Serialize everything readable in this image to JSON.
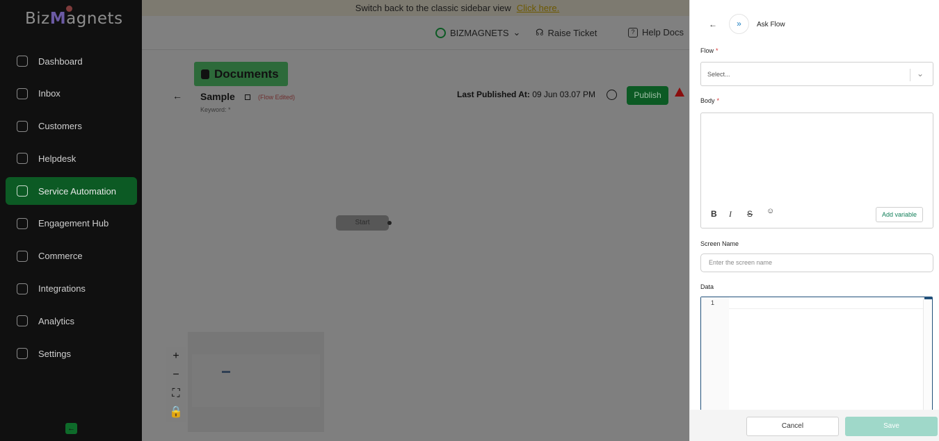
{
  "sidebar": {
    "logo": {
      "pre": "Biz",
      "m": "M",
      "post": "agnets"
    },
    "items": [
      {
        "label": "Dashboard",
        "icon": "grid-icon"
      },
      {
        "label": "Inbox",
        "icon": "chat-icon"
      },
      {
        "label": "Customers",
        "icon": "contacts-icon"
      },
      {
        "label": "Helpdesk",
        "icon": "headset-icon"
      },
      {
        "label": "Service Automation",
        "icon": "gear-bot-icon",
        "active": true
      },
      {
        "label": "Engagement Hub",
        "icon": "megaphone-icon"
      },
      {
        "label": "Commerce",
        "icon": "store-icon"
      },
      {
        "label": "Integrations",
        "icon": "rocket-icon"
      },
      {
        "label": "Analytics",
        "icon": "chart-icon"
      },
      {
        "label": "Settings",
        "icon": "settings-icon"
      }
    ],
    "collapse_glyph": "←"
  },
  "banner": {
    "text": "Switch back to the classic sidebar view",
    "link": "Click here."
  },
  "topbar": {
    "account": "BIZMAGNETS",
    "raise_ticket": "Raise Ticket",
    "help_docs": "Help Docs"
  },
  "flow": {
    "section_title": "Documents",
    "name": "Sample",
    "edited_label": "(Flow Edited)",
    "keyword_label": "Keyword: *",
    "last_published_label": "Last Published At:",
    "last_published_value": "09 Jun 03.07 PM",
    "publish_label": "Publish",
    "start_node": "Start"
  },
  "zoom_controls": [
    "+",
    "−",
    "⛶",
    "🔒"
  ],
  "panel": {
    "title": "Ask Flow",
    "expand_glyph": "»",
    "back_glyph": "←",
    "flow_label": "Flow",
    "flow_placeholder": "Select...",
    "body_label": "Body",
    "format_buttons": [
      "B",
      "I",
      "S",
      "☺"
    ],
    "add_variable": "Add variable",
    "screen_name_label": "Screen Name",
    "screen_name_placeholder": "Enter the screen name",
    "data_label": "Data",
    "line_number": "1",
    "cancel": "Cancel",
    "save": "Save"
  },
  "colors": {
    "accent": "#0c5a24",
    "save_disabled": "#9fd8c9",
    "required": "#d32f2f"
  }
}
